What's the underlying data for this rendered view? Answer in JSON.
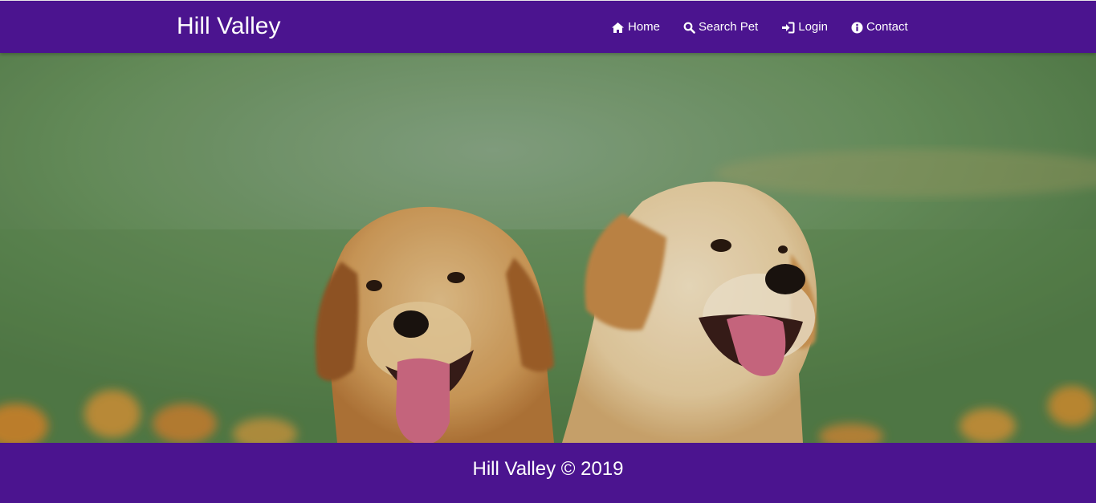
{
  "header": {
    "brand": "Hill Valley",
    "nav": [
      {
        "label": "Home",
        "icon": "home-icon"
      },
      {
        "label": "Search Pet",
        "icon": "search-icon"
      },
      {
        "label": "Login",
        "icon": "login-icon"
      },
      {
        "label": "Contact",
        "icon": "info-icon"
      }
    ]
  },
  "hero": {
    "subject": "two golden retriever puppies"
  },
  "footer": {
    "text": "Hill Valley © 2019"
  },
  "colors": {
    "primary": "#4b148f",
    "text": "#ffffff"
  }
}
